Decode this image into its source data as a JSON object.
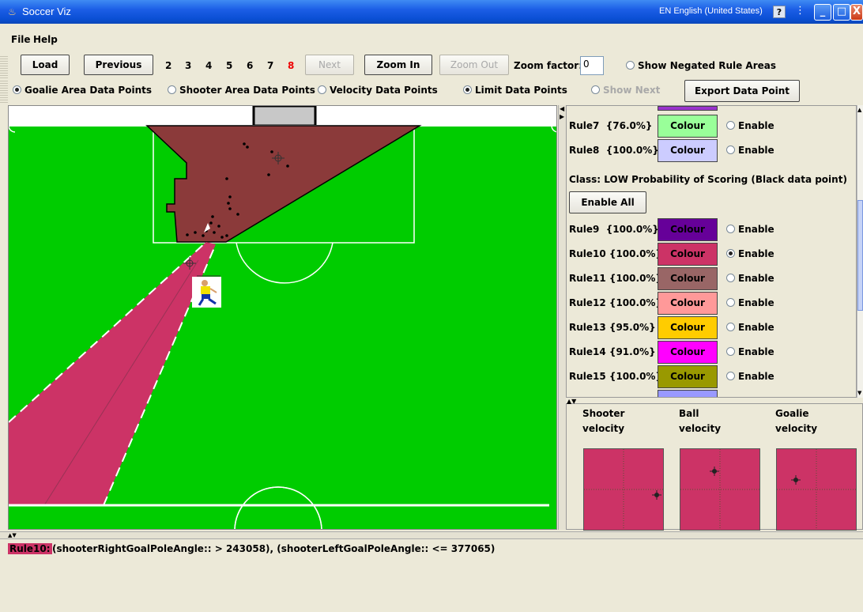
{
  "window": {
    "title": "Soccer Viz",
    "language": "EN English (United States)",
    "help": "?"
  },
  "menu": {
    "file": "File",
    "help": "Help"
  },
  "toolbar": {
    "load": "Load",
    "previous": "Previous",
    "pages": [
      "2",
      "3",
      "4",
      "5",
      "6",
      "7",
      "8"
    ],
    "active_page": "8",
    "next": "Next",
    "zoom_in": "Zoom In",
    "zoom_out": "Zoom Out",
    "zoom_factor_label": "Zoom factor:",
    "zoom_factor_value": "0",
    "show_negated": "Show Negated Rule Areas"
  },
  "toolbar2": {
    "goalie_area": "Goalie Area Data Points",
    "shooter_area": "Shooter Area Data Points",
    "velocity": "Velocity Data Points",
    "limit": "Limit Data Points",
    "show_next": "Show Next",
    "export": "Export Data Point"
  },
  "colors": {
    "pitch": "#00cc00",
    "goal_area": "#8b3a3a",
    "rule_area": "#cc3366"
  },
  "rules_top": [
    {
      "label": "Rule7  {76.0%}",
      "colour": "Colour",
      "swatch": "#99ff99",
      "enable": "Enable",
      "enabled": false
    },
    {
      "label": "Rule8  {100.0%}",
      "colour": "Colour",
      "swatch": "#ccccff",
      "enable": "Enable",
      "enabled": false
    }
  ],
  "class_label": "Class: LOW Probability of Scoring (Black data point)",
  "enable_all": "Enable All",
  "rules_low": [
    {
      "label": "Rule9  {100.0%}",
      "colour": "Colour",
      "swatch": "#660099",
      "enable": "Enable",
      "enabled": false
    },
    {
      "label": "Rule10 {100.0%}",
      "colour": "Colour",
      "swatch": "#cc3366",
      "enable": "Enable",
      "enabled": true
    },
    {
      "label": "Rule11 {100.0%}",
      "colour": "Colour",
      "swatch": "#996666",
      "enable": "Enable",
      "enabled": false
    },
    {
      "label": "Rule12 {100.0%}",
      "colour": "Colour",
      "swatch": "#ff9999",
      "enable": "Enable",
      "enabled": false
    },
    {
      "label": "Rule13 {95.0%}",
      "colour": "Colour",
      "swatch": "#ffcc00",
      "enable": "Enable",
      "enabled": false
    },
    {
      "label": "Rule14 {91.0%}",
      "colour": "Colour",
      "swatch": "#ff00ff",
      "enable": "Enable",
      "enabled": false
    },
    {
      "label": "Rule15 {100.0%}",
      "colour": "Colour",
      "swatch": "#999900",
      "enable": "Enable",
      "enabled": false
    }
  ],
  "velocity": {
    "shooter": "Shooter velocity",
    "ball": "Ball velocity",
    "goalie": "Goalie velocity"
  },
  "status": {
    "rule": "Rule10:",
    "text": "(shooterRightGoalPoleAngle:: > 243058), (shooterLeftGoalPoleAngle:: <= 377065)"
  }
}
